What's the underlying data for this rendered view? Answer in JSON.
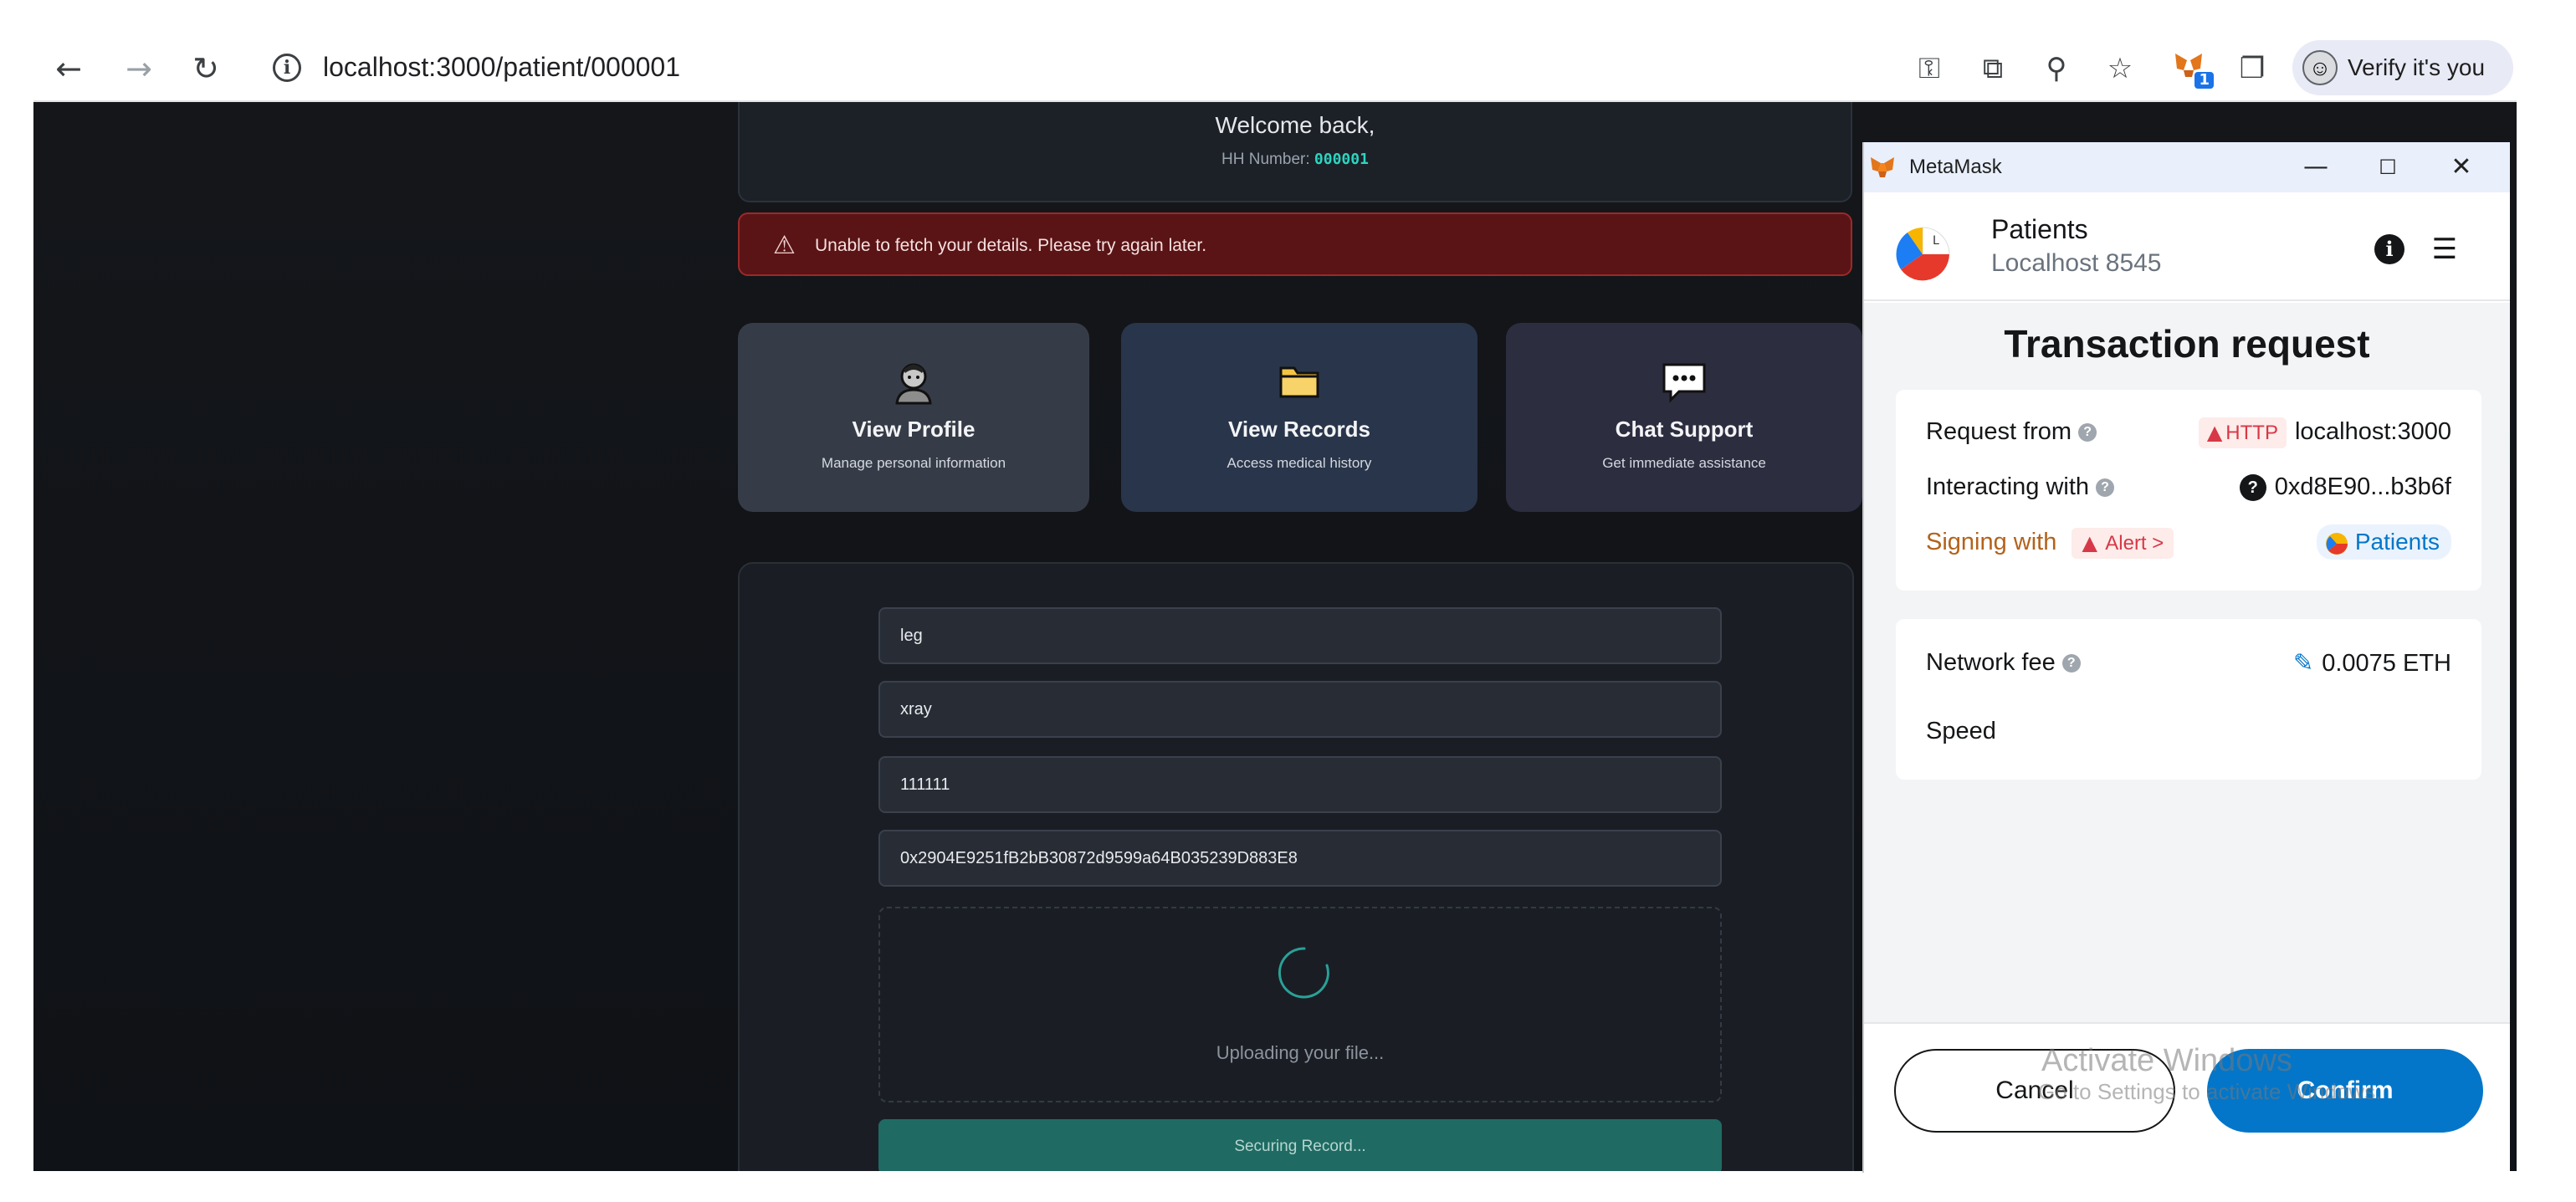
{
  "browser": {
    "url": "localhost:3000/patient/000001",
    "profile_label": "Verify it's you",
    "extension_badge": "1",
    "icons": [
      "back-icon",
      "forward-icon",
      "reload-icon",
      "site-info-icon",
      "password-key-icon",
      "install-app-icon",
      "zoom-icon",
      "bookmark-star-icon",
      "metamask-extension-icon",
      "extensions-puzzle-icon"
    ]
  },
  "welcome": {
    "title": "Welcome back,",
    "hh_label": "HH Number:",
    "hh_value": "000001"
  },
  "error": {
    "message": "Unable to fetch your details. Please try again later."
  },
  "cards": {
    "profile": {
      "title": "View Profile",
      "subtitle": "Manage personal information",
      "icon": "person-icon"
    },
    "records": {
      "title": "View Records",
      "subtitle": "Access medical history",
      "icon": "folder-icon"
    },
    "chat": {
      "title": "Chat Support",
      "subtitle": "Get immediate assistance",
      "icon": "chat-bubble-icon"
    }
  },
  "form": {
    "field_1": "leg",
    "field_2": "xray",
    "field_3": "111111",
    "field_4": "0x2904E9251fB2bB30872d9599a64B035239D883E8",
    "upload_status": "Uploading your file...",
    "submit_label": "Securing Record..."
  },
  "metamask": {
    "window_title": "MetaMask",
    "site_initial": "L",
    "site_name": "Patients",
    "site_host": "Localhost 8545",
    "heading": "Transaction request",
    "request_from_label": "Request from",
    "http_tag": "HTTP",
    "request_from_value": "localhost:3000",
    "interacting_label": "Interacting with",
    "interacting_value": "0xd8E90...b3b6f",
    "signing_label": "Signing with",
    "alert_tag": "Alert",
    "alert_chevron": ">",
    "signing_account": "Patients",
    "network_fee_label": "Network fee",
    "network_fee_value": "0.0075 ETH",
    "speed_label": "Speed",
    "cancel_label": "Cancel",
    "confirm_label": "Confirm"
  },
  "os_watermark": {
    "title": "Activate Windows",
    "subtitle": "Go to Settings to activate Windows."
  },
  "colors": {
    "accent_teal": "#2dd4bf",
    "error_bg": "#5a1416",
    "metamask_blue": "#0376c9",
    "alert_red": "#d73847"
  }
}
